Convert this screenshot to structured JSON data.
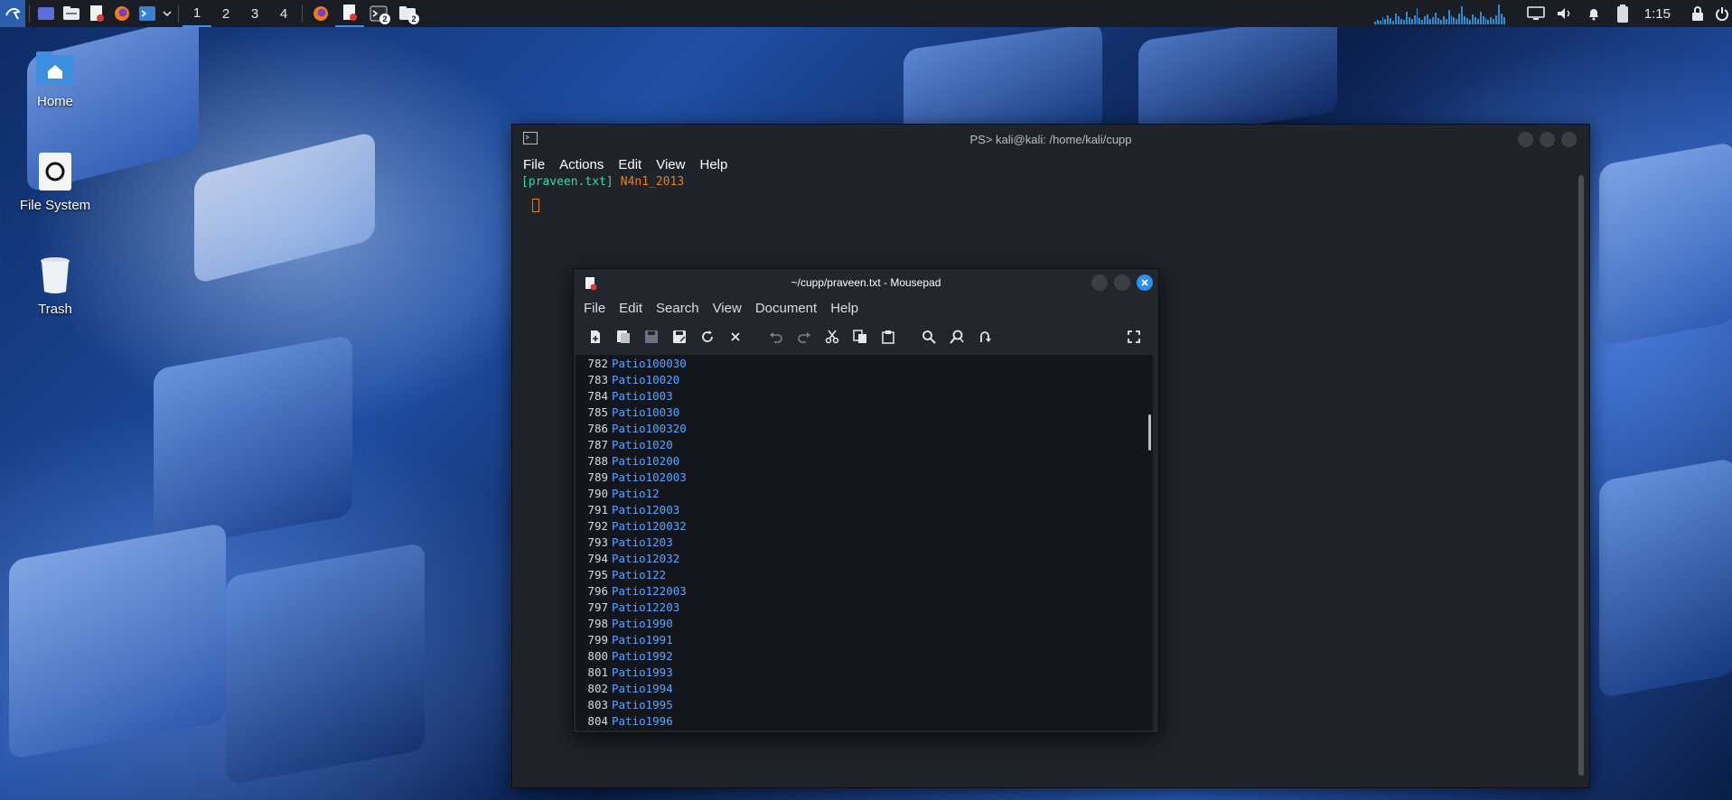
{
  "panel": {
    "workspaces": [
      "1",
      "2",
      "3",
      "4"
    ],
    "task_badges": [
      "2",
      "2"
    ],
    "clock": "1:15",
    "accent": "#3d8fe0"
  },
  "desktop": {
    "icons": [
      {
        "label": "Home",
        "icon": "home-folder-icon"
      },
      {
        "label": "File System",
        "icon": "drive-icon"
      },
      {
        "label": "Trash",
        "icon": "trash-icon"
      }
    ]
  },
  "terminal": {
    "title": "PS> kali@kali: /home/kali/cupp",
    "menu": [
      "File",
      "Actions",
      "Edit",
      "View",
      "Help"
    ],
    "prompt_file": "[praveen.txt]",
    "prompt_text": "N4n1_2013"
  },
  "mousepad": {
    "title": "~/cupp/praveen.txt - Mousepad",
    "menu": [
      "File",
      "Edit",
      "Search",
      "View",
      "Document",
      "Help"
    ],
    "lines": [
      {
        "n": "782",
        "t": "Patio100030"
      },
      {
        "n": "783",
        "t": "Patio10020"
      },
      {
        "n": "784",
        "t": "Patio1003"
      },
      {
        "n": "785",
        "t": "Patio10030"
      },
      {
        "n": "786",
        "t": "Patio100320"
      },
      {
        "n": "787",
        "t": "Patio1020"
      },
      {
        "n": "788",
        "t": "Patio10200"
      },
      {
        "n": "789",
        "t": "Patio102003"
      },
      {
        "n": "790",
        "t": "Patio12"
      },
      {
        "n": "791",
        "t": "Patio12003"
      },
      {
        "n": "792",
        "t": "Patio120032"
      },
      {
        "n": "793",
        "t": "Patio1203"
      },
      {
        "n": "794",
        "t": "Patio12032"
      },
      {
        "n": "795",
        "t": "Patio122"
      },
      {
        "n": "796",
        "t": "Patio122003"
      },
      {
        "n": "797",
        "t": "Patio12203"
      },
      {
        "n": "798",
        "t": "Patio1990"
      },
      {
        "n": "799",
        "t": "Patio1991"
      },
      {
        "n": "800",
        "t": "Patio1992"
      },
      {
        "n": "801",
        "t": "Patio1993"
      },
      {
        "n": "802",
        "t": "Patio1994"
      },
      {
        "n": "803",
        "t": "Patio1995"
      },
      {
        "n": "804",
        "t": "Patio1996"
      }
    ]
  }
}
